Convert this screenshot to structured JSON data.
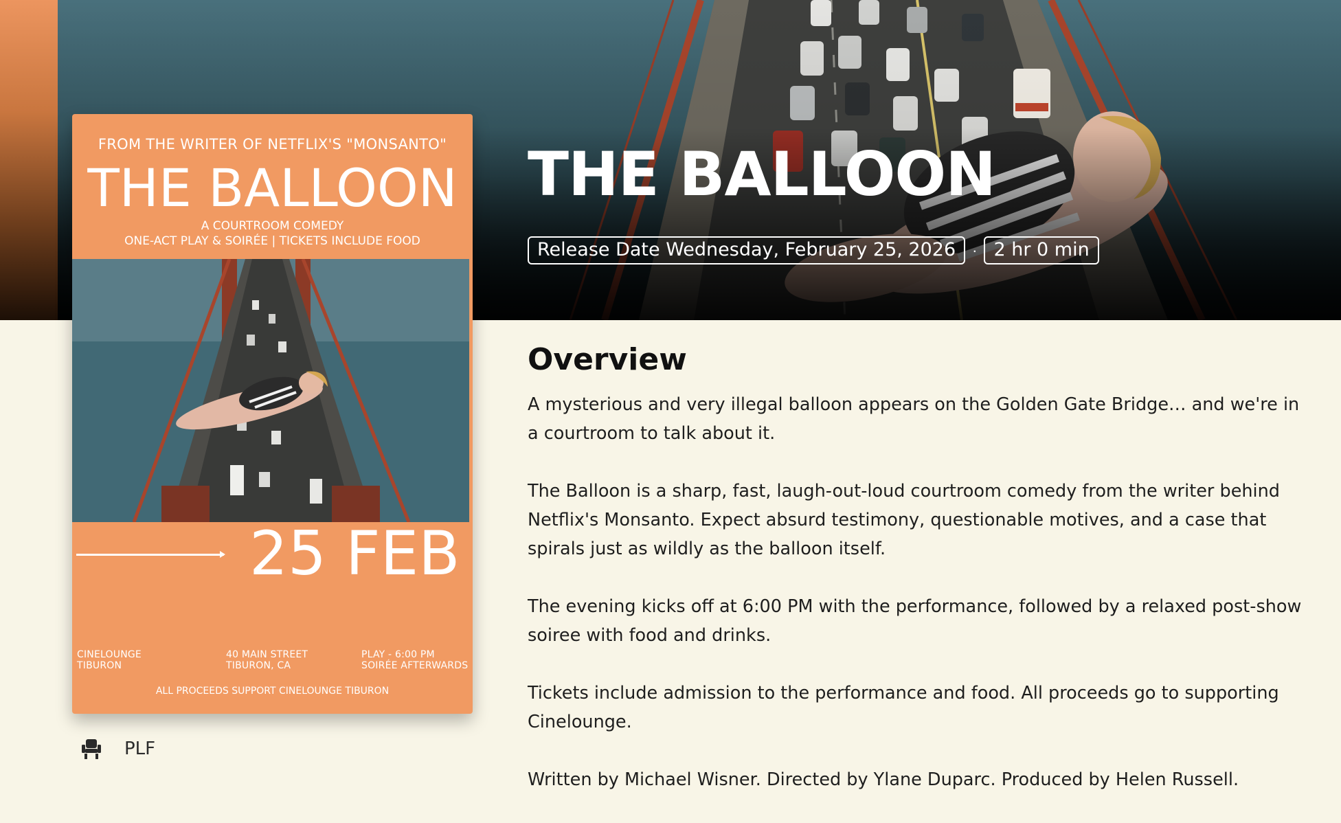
{
  "hero": {
    "title": "THE BALLOON",
    "release_date": "Release Date Wednesday, February 25, 2026",
    "separator": "·",
    "runtime": "2 hr 0 min"
  },
  "poster": {
    "tagline": "FROM THE WRITER OF NETFLIX'S \"MONSANTO\"",
    "title": "THE BALLOON",
    "subtitle_1": "A COURTROOM COMEDY",
    "subtitle_2": "ONE-ACT PLAY & SOIRÉE | TICKETS INCLUDE FOOD",
    "date": "25 FEB",
    "venue_line_1": "CINELOUNGE",
    "venue_line_2": "TIBURON",
    "address_line_1": "40 MAIN STREET",
    "address_line_2": "TIBURON, CA",
    "time_line_1": "PLAY - 6:00 PM",
    "time_line_2": "SOIRÉE AFTERWARDS",
    "proceeds": "ALL PROCEEDS SUPPORT CINELOUNGE TIBURON"
  },
  "features": [
    {
      "icon": "seat-icon",
      "label": "PLF"
    }
  ],
  "overview": {
    "heading": "Overview",
    "paragraphs": [
      "A mysterious and very illegal balloon appears on the Golden Gate Bridge… and we're in a courtroom to talk about it.",
      "The Balloon is a sharp, fast, laugh-out-loud courtroom comedy from the writer behind Netflix's Monsanto. Expect absurd testimony, questionable motives, and a case that spirals just as wildly as the balloon itself.",
      "The evening kicks off at 6:00 PM with the performance, followed by a relaxed post-show soiree with food and drinks.",
      "Tickets include admission to the performance and food. All proceeds go to supporting Cinelounge.",
      "Written by Michael Wisner. Directed by Ylane Duparc. Produced by Helen Russell."
    ]
  },
  "colors": {
    "page_background": "#f8f5e7",
    "poster_orange": "#f19a62",
    "hero_water": "#3f6470",
    "bridge_red": "#a8452c"
  }
}
